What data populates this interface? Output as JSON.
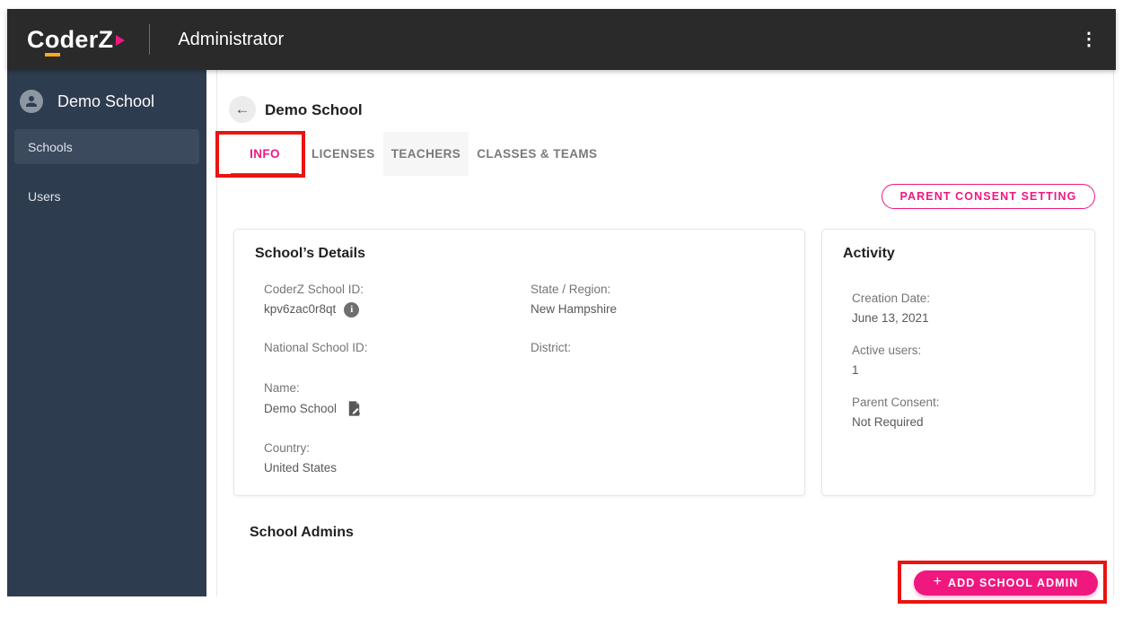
{
  "topbar": {
    "brand": "CoderZ",
    "brand_c": "C",
    "brand_o": "o",
    "brand_rest": "derZ",
    "title": "Administrator"
  },
  "sidebar": {
    "school_name": "Demo School",
    "items": [
      {
        "label": "Schools",
        "active": true
      },
      {
        "label": "Users",
        "active": false
      }
    ]
  },
  "content": {
    "back_title": "Demo School",
    "tabs": [
      {
        "label": "INFO",
        "active": true
      },
      {
        "label": "LICENSES",
        "active": false
      },
      {
        "label": "TEACHERS",
        "active": false
      },
      {
        "label": "CLASSES & TEAMS",
        "active": false
      }
    ],
    "parent_consent_button": "PARENT CONSENT SETTING",
    "details_card": {
      "title": "School’s Details",
      "left": [
        {
          "label": "CoderZ School ID:",
          "value": "kpv6zac0r8qt",
          "icon": "info-icon"
        },
        {
          "label": "National School ID:",
          "value": ""
        },
        {
          "label": "Name:",
          "value": "Demo School",
          "icon": "edit-icon"
        },
        {
          "label": "Country:",
          "value": "United States"
        }
      ],
      "right": [
        {
          "label": "State / Region:",
          "value": "New Hampshire"
        },
        {
          "label": "District:",
          "value": ""
        }
      ]
    },
    "activity_card": {
      "title": "Activity",
      "fields": [
        {
          "label": "Creation Date:",
          "value": "June 13, 2021"
        },
        {
          "label": "Active users:",
          "value": "1"
        },
        {
          "label": "Parent Consent:",
          "value": "Not Required"
        }
      ]
    },
    "admins_section": {
      "title": "School Admins",
      "add_button_plus": "+",
      "add_button_label": "ADD SCHOOL ADMIN"
    }
  },
  "icons": {
    "back": "←",
    "kebab": "⋮",
    "info": "i"
  },
  "colors": {
    "accent_pink": "#f0187f",
    "logo_orange": "#fbaa19",
    "annotation_red": "#eb130f",
    "topbar_bg": "#2a2a2b",
    "sidebar_bg": "#2e3c50",
    "sidebar_selected_bg": "#3c4a5e"
  }
}
